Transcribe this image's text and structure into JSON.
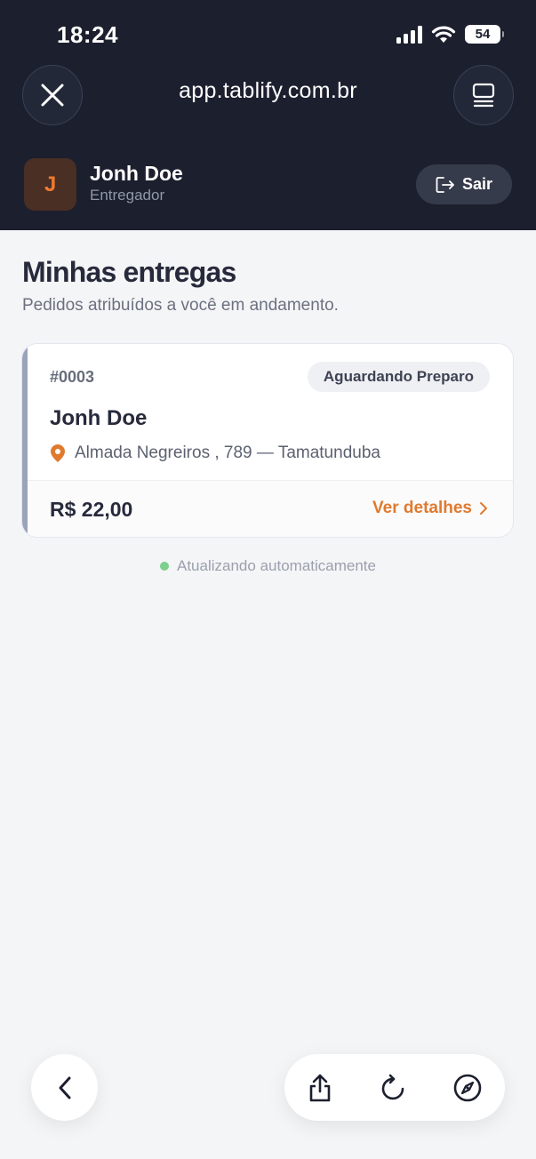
{
  "status_bar": {
    "time": "18:24",
    "battery": "54"
  },
  "browser": {
    "url": "app.tablify.com.br"
  },
  "user": {
    "initial": "J",
    "name": "Jonh Doe",
    "role": "Entregador",
    "logout_label": "Sair"
  },
  "page": {
    "title": "Minhas entregas",
    "subtitle": "Pedidos atribuídos a você em andamento."
  },
  "orders": [
    {
      "id": "#0003",
      "status": "Aguardando Preparo",
      "customer": "Jonh Doe",
      "address": "Almada Negreiros , 789 — Tamatunduba",
      "total": "R$ 22,00",
      "details_label": "Ver detalhes"
    }
  ],
  "auto_refresh": {
    "text": "Atualizando automaticamente"
  },
  "colors": {
    "header_bg": "#1c1f2e",
    "accent": "#e07a2e",
    "live_dot": "#7dcf8c",
    "card_accent": "#9aa3bb"
  },
  "icons": [
    "close-icon",
    "tabs-icon",
    "logout-icon",
    "location-pin-icon",
    "chevron-right-icon",
    "back-icon",
    "share-icon",
    "reload-icon",
    "compass-icon",
    "signal-icon",
    "wifi-icon",
    "battery-icon"
  ]
}
